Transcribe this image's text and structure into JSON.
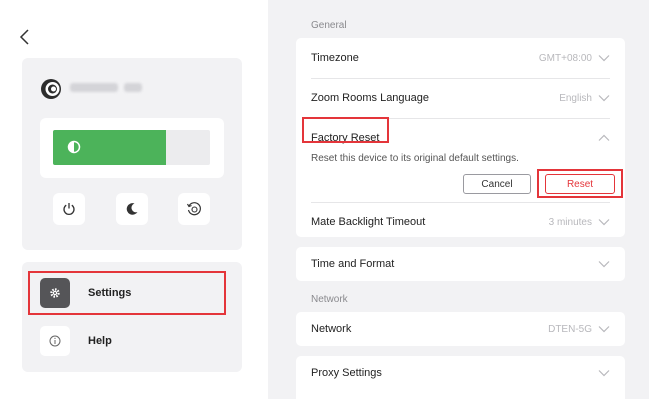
{
  "colors": {
    "accent_green": "#4cb35a",
    "danger_red": "#e4353a",
    "panel_bg": "#f2f2f4"
  },
  "device": {
    "brightness_fraction": 0.72
  },
  "controls": [
    {
      "name": "power-button",
      "icon": "power-icon"
    },
    {
      "name": "sleep-button",
      "icon": "moon-icon"
    },
    {
      "name": "restart-button",
      "icon": "restart-icon"
    }
  ],
  "menu": {
    "items": [
      {
        "label": "Settings",
        "icon": "gear-icon"
      },
      {
        "label": "Help",
        "icon": "info-icon"
      }
    ]
  },
  "general": {
    "title": "General",
    "timezone": {
      "label": "Timezone",
      "value": "GMT+08:00"
    },
    "language": {
      "label": "Zoom Rooms Language",
      "value": "English"
    },
    "factory_reset": {
      "label": "Factory Reset",
      "description": "Reset this device to its original default settings.",
      "cancel_label": "Cancel",
      "reset_label": "Reset"
    },
    "backlight": {
      "label": "Mate Backlight Timeout",
      "value": "3 minutes"
    }
  },
  "time_format": {
    "label": "Time and Format"
  },
  "network": {
    "title": "Network",
    "network_row": {
      "label": "Network",
      "value": "DTEN-5G"
    }
  },
  "proxy": {
    "label": "Proxy Settings"
  }
}
